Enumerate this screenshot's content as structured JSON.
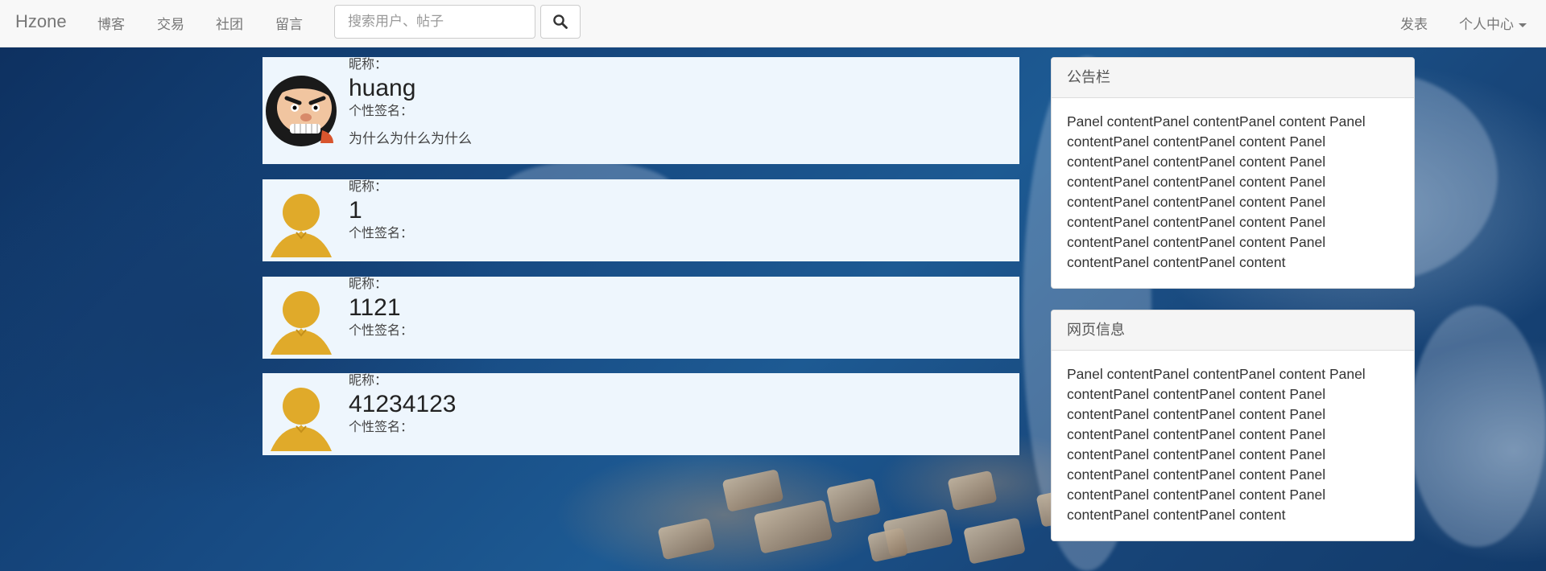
{
  "navbar": {
    "brand": "Hzone",
    "links": [
      "博客",
      "交易",
      "社团",
      "留言"
    ],
    "search_placeholder": "搜索用户、帖子",
    "right_links": {
      "publish": "发表",
      "personal_center": "个人中心"
    }
  },
  "users": [
    {
      "nickname_label": "昵称：",
      "nickname": "huang",
      "signature_label": "个性签名：",
      "signature": "为什么为什么为什么",
      "avatar": "cartoon-avatar"
    },
    {
      "nickname_label": "昵称：",
      "nickname": "1",
      "signature_label": "个性签名：",
      "signature": "",
      "avatar": "default-person-avatar"
    },
    {
      "nickname_label": "昵称：",
      "nickname": "1121",
      "signature_label": "个性签名：",
      "signature": "",
      "avatar": "default-person-avatar"
    },
    {
      "nickname_label": "昵称：",
      "nickname": "41234123",
      "signature_label": "个性签名：",
      "signature": "",
      "avatar": "default-person-avatar"
    }
  ],
  "panels": [
    {
      "title": "公告栏",
      "body": "Panel contentPanel contentPanel content Panel contentPanel contentPanel content Panel contentPanel contentPanel content Panel contentPanel contentPanel content Panel contentPanel contentPanel content Panel contentPanel contentPanel content Panel contentPanel contentPanel content Panel contentPanel contentPanel content"
    },
    {
      "title": "网页信息",
      "body": "Panel contentPanel contentPanel content Panel contentPanel contentPanel content Panel contentPanel contentPanel content Panel contentPanel contentPanel content Panel contentPanel contentPanel content Panel contentPanel contentPanel content Panel contentPanel contentPanel content Panel contentPanel contentPanel content"
    }
  ],
  "colors": {
    "navbar_bg": "#f8f8f8",
    "card_bg": "#eef6fd",
    "avatar_gold": "#e0aa2a"
  }
}
